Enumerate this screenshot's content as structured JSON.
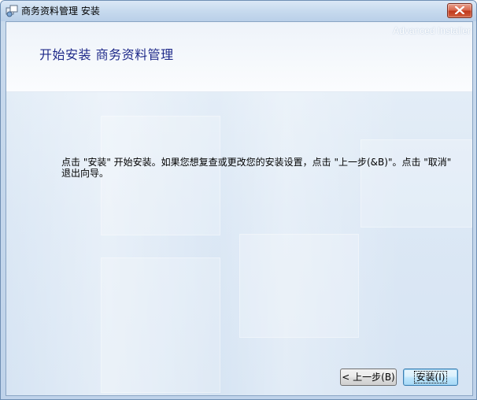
{
  "window": {
    "title": "商务资料管理 安装",
    "close_icon": "close-icon",
    "app_icon": "installer-icon"
  },
  "banner": {
    "heading": "开始安装 商务资料管理",
    "watermark": "Advanced Installer"
  },
  "content": {
    "instructions": "点击 \"安装\" 开始安装。如果您想复查或更改您的安装设置，点击 \"上一步(&B)\"。点击 \"取消\" 退出向导。"
  },
  "buttons": {
    "back_label": "< 上一步(B)",
    "install_label": "安装(I)"
  },
  "colors": {
    "heading": "#1f2a8a",
    "close_button": "#c0391c",
    "default_button_border": "#3c7fb1"
  }
}
